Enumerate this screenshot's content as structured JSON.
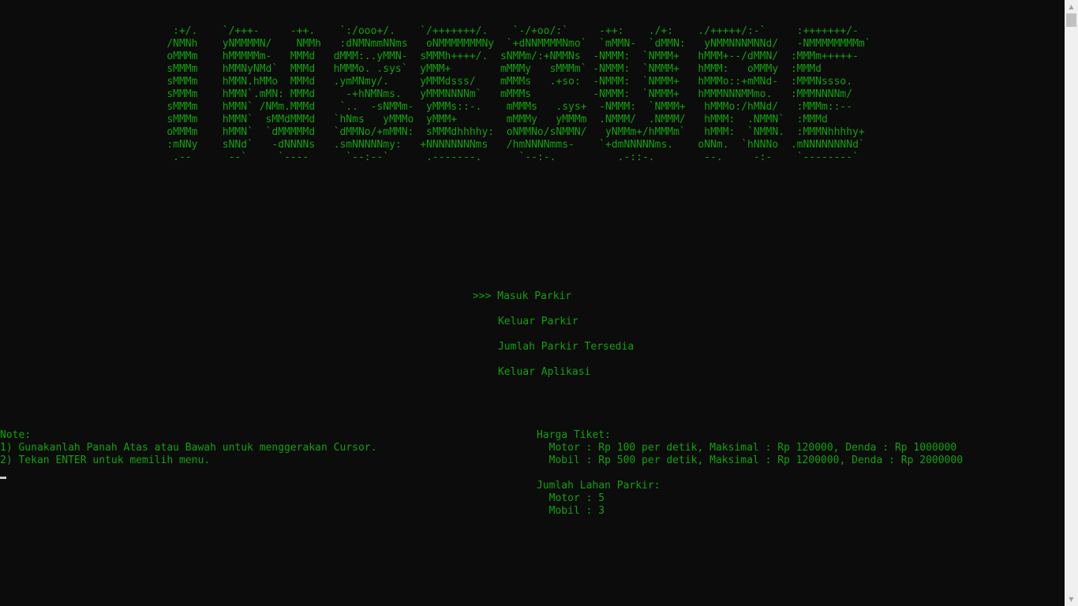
{
  "colors": {
    "background": "#0c0c0c",
    "text": "#13a10e",
    "cursor": "#cccccc",
    "scrollbar_track": "#f0f0f0",
    "scrollbar_thumb": "#c1c1c1"
  },
  "banner": {
    "lines": [
      "                            :+/.    `/+++-     -++.    `:/ooo+/.    `/+++++++/.    `-/+oo/:`     -++:    ./+:    ./+++++/:-`     :+++++++/-",
      "                           /NMNh    yNMMMMN/    NMMh   :dNMNmmNNms   oNMMMMMMMNy  `+dNNMMMMNmo`  `mMMN-  `dMMN:   yNMMNNNMNNd/   -NMMMMMMMMm`",
      "                           oMMMm    hMMMMMm-   MMMd   dMMM:..yMMN-  sMMMh++++/.  sNMMm/:+NMMNs  -NMMM:  `NMMM+   hMMM+--/dMMN/  :MMMm+++++-",
      "                           sMMMm    hMMNyNMd`  MMMd   hMMMo. .sys`  yMMM+        mMMMy   sMMMm` -NMMM:  `NMMM+   hMMM:   oMMMy  :MMMd",
      "                           sMMMm    hMMN.hMMo  MMMd   .ymMNmy/.     yMMMdsss/    mMMMs   .+so:  -NMMM:  `NMMM+   hMMMo::+mMNd-  :MMMNssso.",
      "                           sMMMm    hMMN`.mMN: MMMd     -+hNMNms.   yMMMNNNNm`   mMMMs          -NMMM:  `NMMM+   hMMMNNNMMmo.   :MMMNNNNm/",
      "                           sMMMm    hMMN` /NMm.MMMd    `..  -sNMMm-  yMMMs::-.    mMMMs   .sys+  -NMMM:  `NMMM+   hMMMo:/hMNd/   :MMMm::--",
      "                           sMMMm    hMMN`  sMMdMMMd   `hNms   yMMMo  yMMM+        mMMMy   yMMMm  .NMMM/  .NMMM/   hMMM:  .NMMN`  :MMMd",
      "                           oMMMm    hMMN`  `dMMMMMd   `dMMNo/+mMMN:  sMMMdhhhhy:  oNMMNo/sNMMN/   yNMMm+/hMMMm`   hMMM:  `NMMN.  :MMMNhhhhy+",
      "                           :mNNy    sNNd`   -dNNNNs   .smNNNNNmy:   +NNNNNNNNms   /hmNNNNmms-    `+dmNNNNNms.    oNNm.  `hNNNo  .mNNNNNNNNd`",
      "                            .--      --`     `----      `--:--`      .-------.      `--:-.          .-::-.        --.     -:-    `--------`"
    ]
  },
  "menu": {
    "pointer": ">>>",
    "items": [
      {
        "label": "Masuk Parkir"
      },
      {
        "label": "Keluar Parkir"
      },
      {
        "label": "Jumlah Parkir Tersedia"
      },
      {
        "label": "Keluar Aplikasi"
      }
    ]
  },
  "note": {
    "title": "Note:",
    "lines": [
      "1) Gunakanlah Panah Atas atau Bawah untuk menggerakan Cursor.",
      "2) Tekan ENTER untuk memilih menu."
    ]
  },
  "harga": {
    "title": "Harga Tiket:",
    "lines": [
      "  Motor : Rp 100 per detik, Maksimal : Rp 120000, Denda : Rp 1000000",
      "  Mobil : Rp 500 per detik, Maksimal : Rp 1200000, Denda : Rp 2000000"
    ]
  },
  "lahan": {
    "title": "Jumlah Lahan Parkir:",
    "lines": [
      "  Motor : 5",
      "  Mobil : 3"
    ]
  },
  "scrollbar": {
    "up_icon": "▲",
    "down_icon": "▼"
  }
}
